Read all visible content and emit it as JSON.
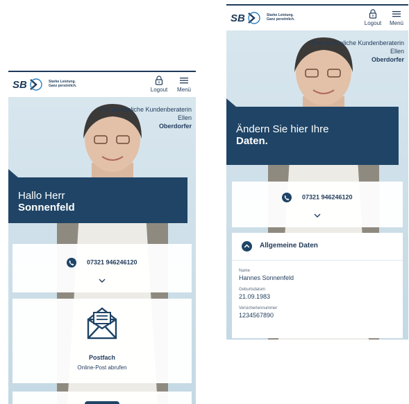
{
  "left": {
    "header": {
      "brand": "SBK",
      "tagline_line1": "Starke Leistung.",
      "tagline_line2": "Ganz persönlich.",
      "logout_label": "Logout",
      "menu_label": "Menü"
    },
    "advisor": {
      "line1": "Ihre persönliche Kundenberaterin",
      "first_name": "Ellen",
      "last_name": "Oberdorfer"
    },
    "greeting": {
      "line1": "Hallo Herr",
      "line2": "Sonnenfeld"
    },
    "contact": {
      "phone": "07321 946246120"
    },
    "postfach": {
      "title": "Postfach",
      "subtitle": "Online-Post abrufen"
    }
  },
  "right": {
    "header": {
      "brand": "SBK",
      "tagline_line1": "Starke Leistung.",
      "tagline_line2": "Ganz persönlich.",
      "logout_label": "Logout",
      "menu_label": "Menü"
    },
    "advisor": {
      "line1": "Ihre persönliche Kundenberaterin",
      "first_name": "Ellen",
      "last_name": "Oberdorfer"
    },
    "headline": {
      "line1": "Ändern Sie hier Ihre",
      "line2": "Daten."
    },
    "contact": {
      "phone": "07321 946246120"
    },
    "section": {
      "title": "Allgemeine Daten",
      "fields": [
        {
          "label": "Name",
          "value": "Hannes Sonnenfeld"
        },
        {
          "label": "Geburtsdatum",
          "value": "21.09.1983"
        },
        {
          "label": "Versichertennummer",
          "value": "1234567890"
        }
      ]
    }
  },
  "colors": {
    "brand_navy": "#1f4466",
    "text_navy": "#1f3a5a",
    "hero_bg": "#d8e6ee",
    "card_bg": "#ffffff"
  },
  "icons": [
    "sbk-logo",
    "lock-icon",
    "menu-icon",
    "phone-icon",
    "chevron-down-icon",
    "envelope-icon",
    "chevron-up-icon"
  ]
}
